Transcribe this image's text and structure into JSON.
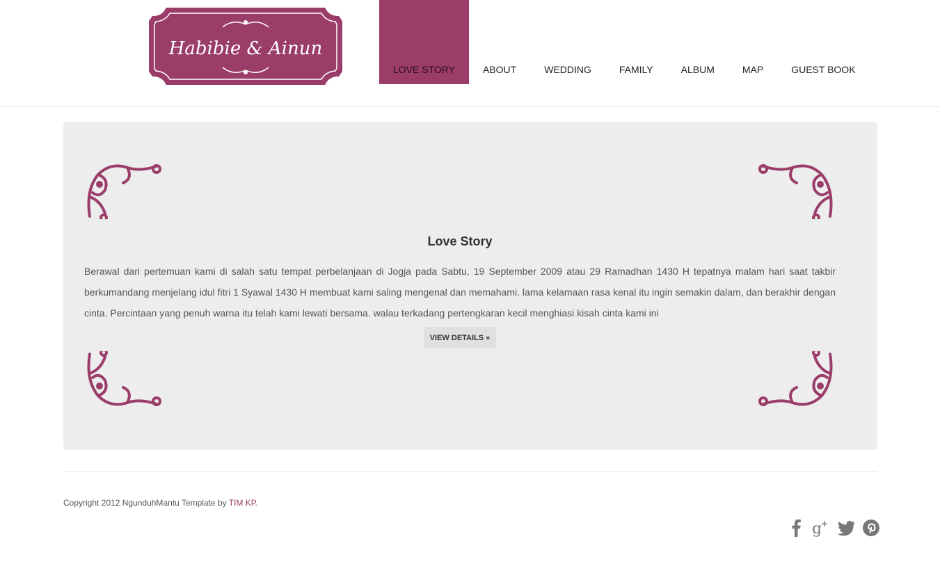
{
  "brand": {
    "logo_text": "Habibie & Ainun",
    "color": "#9a3d69"
  },
  "nav": {
    "items": [
      {
        "label": "LOVE STORY",
        "active": true
      },
      {
        "label": "ABOUT"
      },
      {
        "label": "WEDDING"
      },
      {
        "label": "FAMILY"
      },
      {
        "label": "ALBUM"
      },
      {
        "label": "MAP"
      },
      {
        "label": "GUEST BOOK"
      }
    ]
  },
  "main": {
    "title": "Love Story",
    "body": "Berawal dari pertemuan kami di salah satu tempat perbelanjaan di Jogja pada Sabtu, 19 September 2009 atau 29 Ramadhan 1430 H tepatnya malam hari saat takbir berkumandang menjelang idul fitri 1 Syawal 1430 H membuat kami saling mengenal dan memahami. lama kelamaan rasa kenal itu ingin semakin dalam, dan berakhir dengan cinta. Percintaan yang penuh warna itu telah kami lewati bersama. walau terkadang pertengkaran kecil menghiasi kisah cinta kami ini",
    "button_label": "VIEW DETAILS »"
  },
  "footer": {
    "copyright_prefix": "Copyright 2012 NgunduhMantu Template by ",
    "link_text": "TIM KP",
    "copyright_suffix": ".",
    "social_icons": [
      "facebook-icon",
      "google-plus-icon",
      "twitter-icon",
      "pinterest-icon"
    ]
  }
}
